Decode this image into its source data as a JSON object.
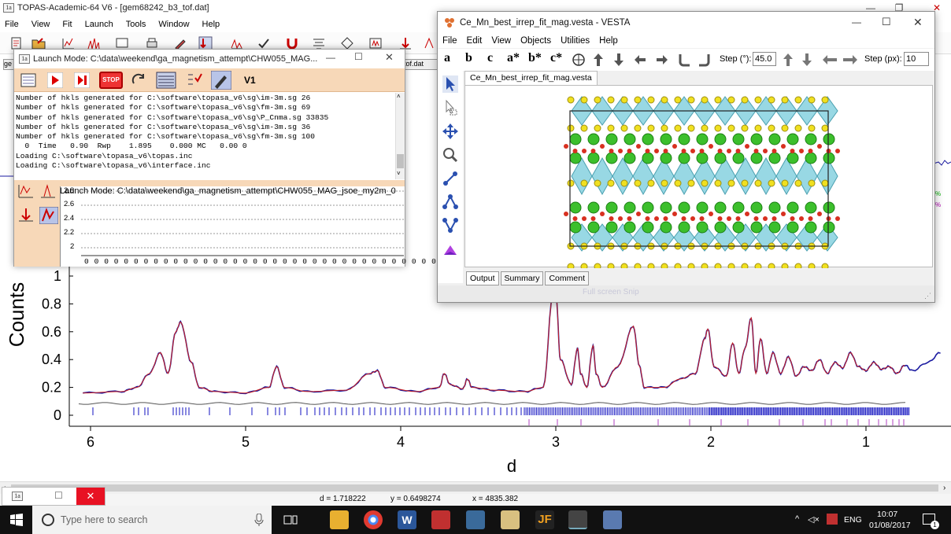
{
  "topas": {
    "title": "TOPAS-Academic-64 V6 - [gem68242_b3_tof.dat]",
    "menu": [
      "File",
      "View",
      "Fit",
      "Launch",
      "Tools",
      "Window",
      "Help"
    ],
    "file_tab_left": "ge",
    "file_tab_right": "tof.dat"
  },
  "launch": {
    "title": "Launch Mode: C:\\data\\weekend\\ga_magnetism_attempt\\CHW055_MAG...",
    "v1_label": "V1",
    "stop_label": "STOP",
    "log_lines": [
      "Number of hkls generated for C:\\software\\topasa_v6\\sg\\im-3m.sg 26",
      "Number of hkls generated for C:\\software\\topasa_v6\\sg\\fm-3m.sg 69",
      "Number of hkls generated for C:\\software\\topasa_v6\\sg\\P_Cnma.sg 33835",
      "Number of hkls generated for C:\\software\\topasa_v6\\sg\\im-3m.sg 36",
      "Number of hkls generated for C:\\software\\topasa_v6\\sg\\fm-3m.sg 100",
      "  0  Time   0.90  Rwp    1.895    0.000 MC   0.00 0",
      "Loading C:\\software\\topasa_v6\\topas.inc",
      "Loading C:\\software\\topasa_v6\\interface.inc"
    ],
    "second_title": "Launch Mode: C:\\data\\weekend\\ga_magnetism_attempt\\CHW055_MAG_jsoe_my2m_0",
    "plot_ticks": [
      "2.8",
      "2.6",
      "2.4",
      "2.2",
      "2"
    ],
    "x_zero_row": "0 0 0 0 0 0 0 0 0 0 0 0 0 0 0 0 0 0 0 0 0 0 0 0 0 0 0 0 0 0 0 0 0 0 0 0 0 0 0 0 0 0"
  },
  "vesta": {
    "title": "Ce_Mn_best_irrep_fit_mag.vesta - VESTA",
    "menu": [
      "File",
      "Edit",
      "View",
      "Objects",
      "Utilities",
      "Help"
    ],
    "axis_buttons": [
      "a",
      "b",
      "c",
      "a*",
      "b*",
      "c*"
    ],
    "step_deg_label": "Step (°):",
    "step_deg_value": "45.0",
    "step_px_label": "Step (px):",
    "step_px_value": "10",
    "tab": "Ce_Mn_best_irrep_fit_mag.vesta",
    "bottom_tabs": [
      "Output",
      "Summary",
      "Comment"
    ],
    "bottom_hint": "Full screen Snip"
  },
  "chart_data": {
    "type": "line",
    "ylabel": "Counts",
    "xlabel": "d",
    "x_ticks": [
      6,
      5,
      4,
      3,
      2,
      1
    ],
    "y_ticks": [
      0,
      0.2,
      0.4,
      0.6,
      0.8,
      1
    ],
    "x_range": [
      6.12,
      0.52
    ],
    "ylim": [
      -0.05,
      1.05
    ],
    "series": [
      {
        "x": [
          6.05,
          5.8,
          5.7,
          5.62,
          5.55,
          5.5,
          5.45,
          5.42,
          5.35,
          5.3,
          5.2,
          5.0,
          4.85,
          4.8,
          4.75,
          4.6,
          4.35,
          4.2,
          4.15,
          4.1,
          3.9,
          3.75,
          3.72,
          3.68,
          3.6,
          3.57,
          3.54,
          3.4,
          3.2,
          3.08,
          3.02,
          3.0,
          2.97,
          2.9,
          2.86,
          2.84,
          2.8,
          2.76,
          2.74,
          2.7,
          2.6,
          2.5,
          2.46,
          2.43,
          2.3,
          2.2,
          2.1,
          2.04,
          2.02,
          1.98,
          1.9,
          1.86,
          1.82,
          1.78,
          1.74,
          1.71,
          1.68,
          1.64,
          1.6,
          1.55,
          1.5,
          1.45,
          1.4,
          1.35,
          1.3,
          1.25,
          1.2,
          1.15,
          1.1,
          1.05,
          1.0,
          0.95,
          0.9,
          0.85,
          0.8,
          0.75,
          0.7,
          0.6,
          0.52
        ],
        "y": [
          0.16,
          0.17,
          0.2,
          0.3,
          0.45,
          0.3,
          0.6,
          0.67,
          0.38,
          0.2,
          0.17,
          0.16,
          0.2,
          0.35,
          0.2,
          0.17,
          0.18,
          0.3,
          0.32,
          0.2,
          0.17,
          0.2,
          0.3,
          0.22,
          0.19,
          0.26,
          0.2,
          0.18,
          0.17,
          0.2,
          0.85,
          0.88,
          0.4,
          0.22,
          0.48,
          0.3,
          0.2,
          0.5,
          0.3,
          0.2,
          0.35,
          0.64,
          0.35,
          0.2,
          0.2,
          0.26,
          0.3,
          0.55,
          0.62,
          0.35,
          0.28,
          0.52,
          0.3,
          0.48,
          0.7,
          0.3,
          0.55,
          0.3,
          0.45,
          0.3,
          0.42,
          0.28,
          0.35,
          0.32,
          0.4,
          0.3,
          0.38,
          0.34,
          0.45,
          0.35,
          0.32,
          0.38,
          0.33,
          0.35,
          0.3,
          0.36,
          0.32,
          0.38,
          0.45
        ]
      }
    ]
  },
  "status": {
    "d": "d = 1.718222",
    "y": "y = 0.6498274",
    "x": "x = 4835.382"
  },
  "taskbar": {
    "search_placeholder": "Type here to search",
    "lang": "ENG",
    "time": "10:07",
    "date": "01/08/2017",
    "notif_count": "1"
  },
  "colors": {
    "obs": "#1a1aa0",
    "calc": "#cc2020",
    "tick_blue": "#1010c0",
    "tick_purple": "#b040c0",
    "launch_bg": "#f7d8b8"
  }
}
